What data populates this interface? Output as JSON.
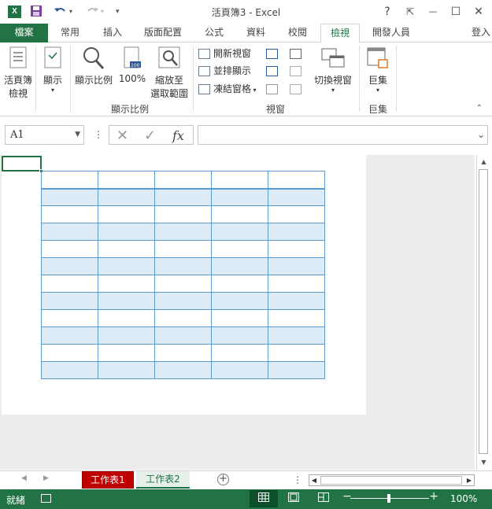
{
  "titlebar": {
    "app_icon": "X",
    "title": "活頁簿3 - Excel",
    "help": "?",
    "restore_ribbon": "⇱",
    "minimize": "—",
    "maximize": "☐",
    "close": "✕"
  },
  "tabs": {
    "file": "檔案",
    "home": "常用",
    "insert": "插入",
    "layout": "版面配置",
    "formulas": "公式",
    "data": "資料",
    "review": "校閱",
    "view": "檢視",
    "developer": "開發人員",
    "signin": "登入"
  },
  "ribbon": {
    "workbook_views_label1": "活頁簿",
    "workbook_views_label2": "檢視",
    "show_label": "顯示",
    "zoom_label": "顯示比例",
    "zoom100_label": "100%",
    "zoom_selection_label1": "縮放至",
    "zoom_selection_label2": "選取範圍",
    "zoom_group": "顯示比例",
    "new_window": "開新視窗",
    "arrange_all": "並排顯示",
    "freeze_panes": "凍結窗格",
    "window_group": "視窗",
    "switch_windows": "切換視窗",
    "macros_label": "巨集",
    "macros_group": "巨集"
  },
  "formula_bar": {
    "name_box": "A1",
    "fx": "fx",
    "value": ""
  },
  "table": {
    "columns": 5,
    "rows": 12
  },
  "sheets": {
    "sheet1": "工作表1",
    "sheet2": "工作表2"
  },
  "status": {
    "ready": "就緒",
    "zoom": "100%",
    "zoom_level": 1.0
  },
  "colors": {
    "accent": "#217346",
    "sheet1_tab": "#c00000",
    "table_border": "#5b9bd5",
    "table_band": "#ddebf7"
  }
}
